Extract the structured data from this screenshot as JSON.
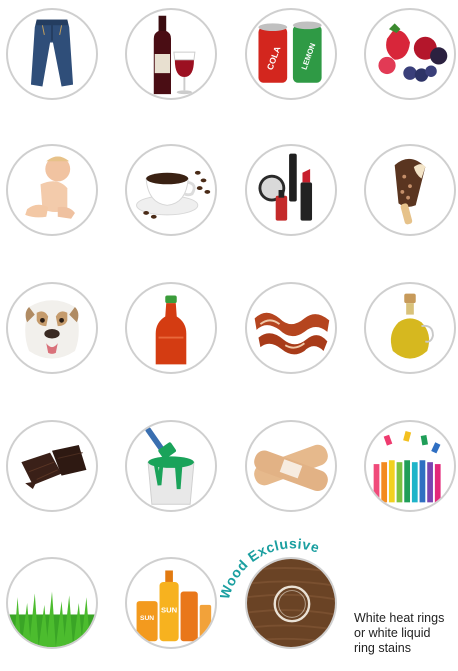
{
  "stains": [
    {
      "name": "jeans",
      "icon": "jeans-icon"
    },
    {
      "name": "red wine",
      "icon": "wine-icon"
    },
    {
      "name": "soda cans",
      "icon": "soda-can-icon"
    },
    {
      "name": "berries",
      "icon": "berries-icon"
    },
    {
      "name": "baby",
      "icon": "baby-icon"
    },
    {
      "name": "coffee",
      "icon": "coffee-icon"
    },
    {
      "name": "makeup",
      "icon": "makeup-icon"
    },
    {
      "name": "ice cream",
      "icon": "ice-cream-icon"
    },
    {
      "name": "dog",
      "icon": "dog-icon"
    },
    {
      "name": "hot sauce",
      "icon": "hot-sauce-icon"
    },
    {
      "name": "bacon",
      "icon": "bacon-icon"
    },
    {
      "name": "oil",
      "icon": "oil-icon"
    },
    {
      "name": "chocolate",
      "icon": "chocolate-icon"
    },
    {
      "name": "paint",
      "icon": "paint-icon"
    },
    {
      "name": "bandages",
      "icon": "bandage-icon"
    },
    {
      "name": "markers",
      "icon": "markers-icon"
    },
    {
      "name": "grass",
      "icon": "grass-icon"
    },
    {
      "name": "sunscreen",
      "icon": "sunscreen-icon"
    },
    {
      "name": "wood ring stain",
      "icon": "wood-stain-icon"
    }
  ],
  "soda_labels": {
    "left": "COLA",
    "right": "LEMON"
  },
  "sunscreen_label": "SUN",
  "wood": {
    "badge": "Wood Exclusive",
    "caption": "White heat rings\nor white liquid\nring stains",
    "accent_color": "#1a9fa0"
  }
}
